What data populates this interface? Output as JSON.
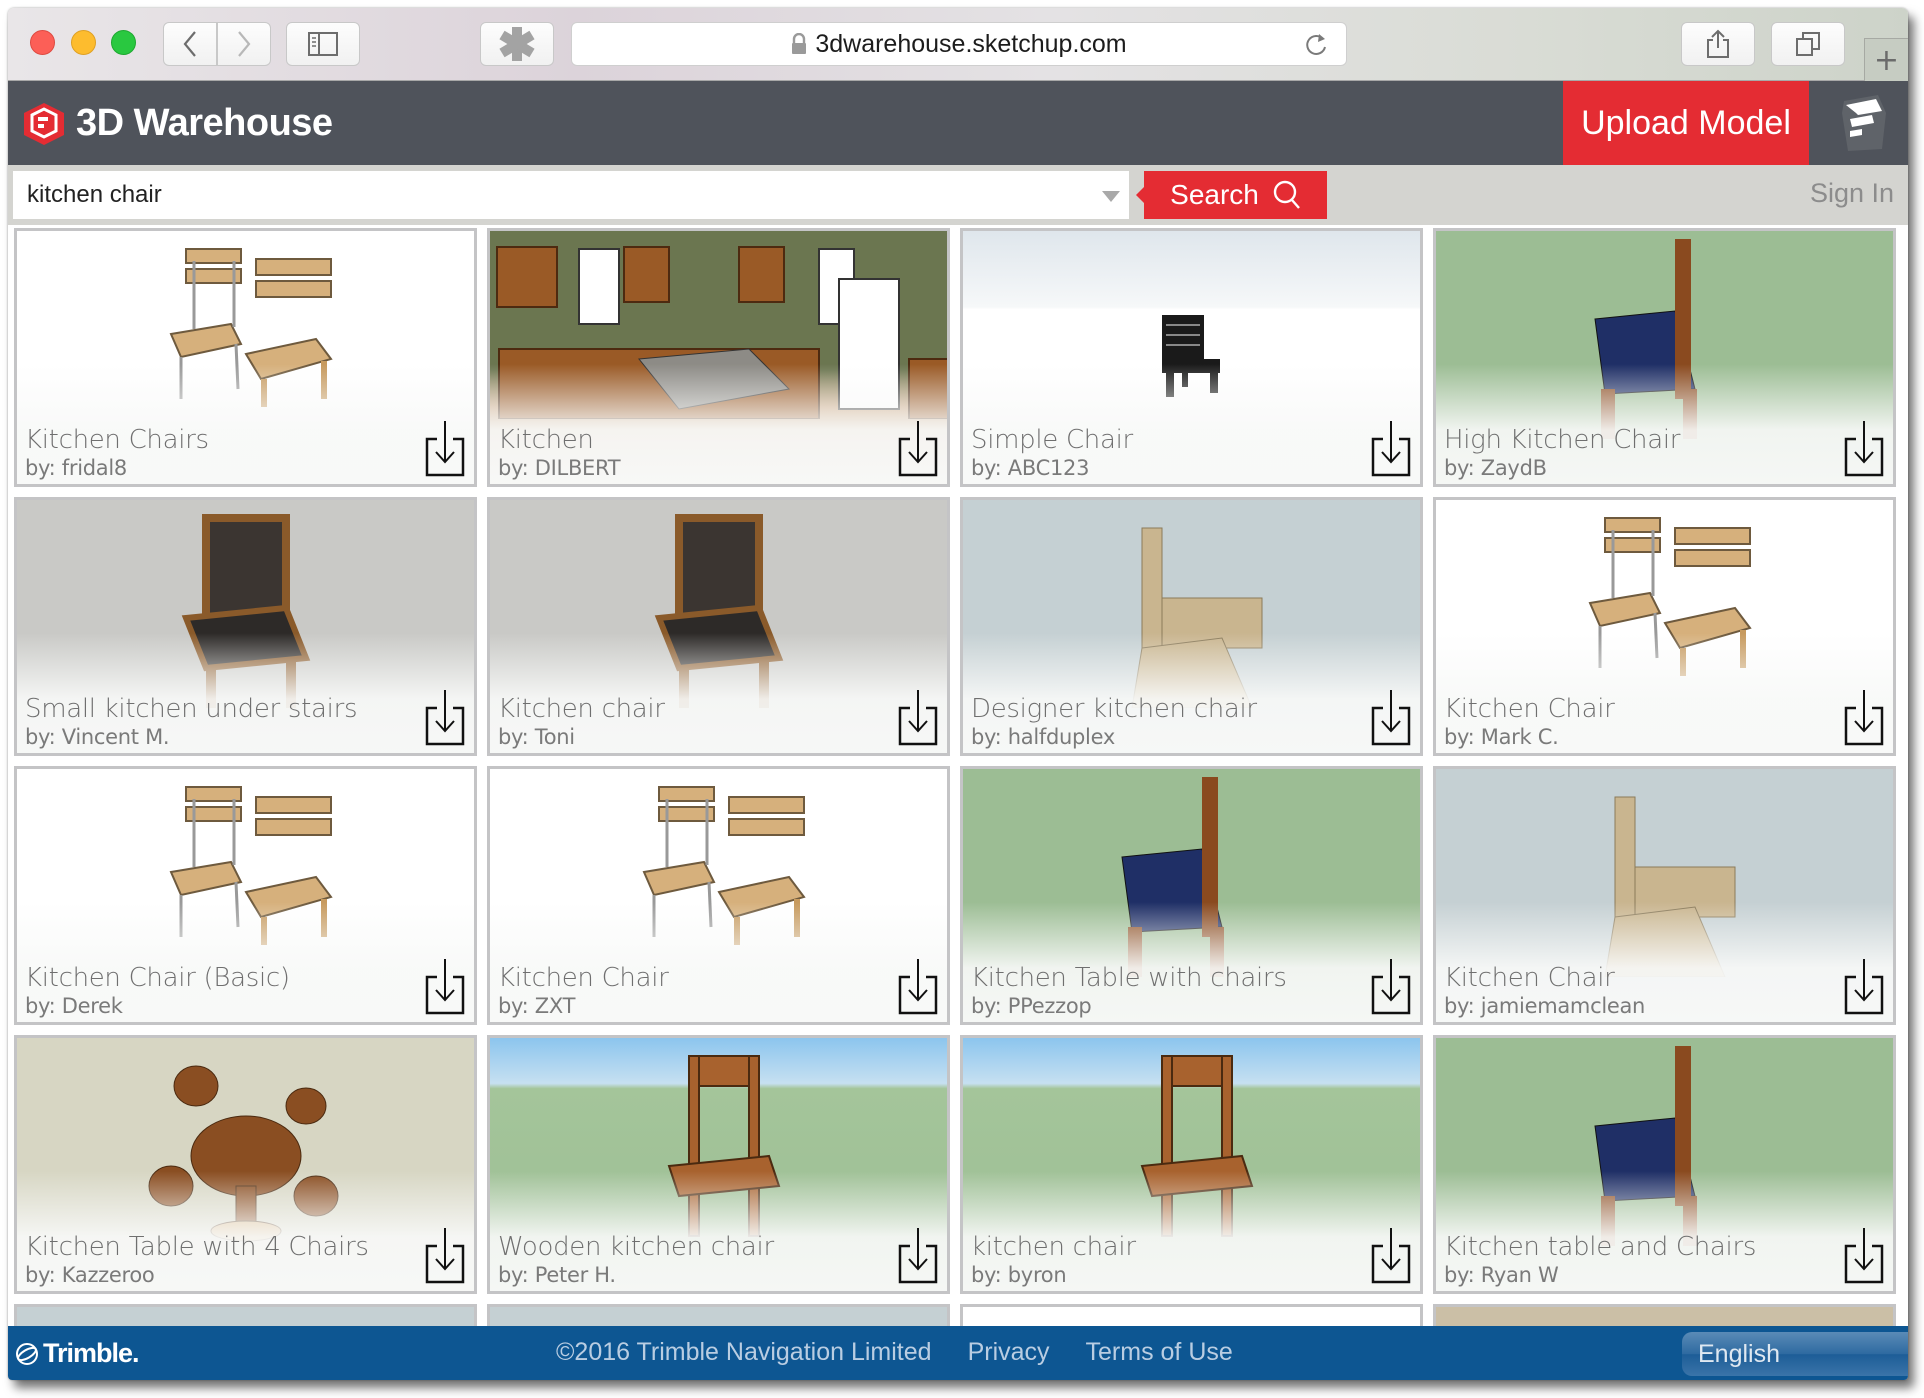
{
  "browser": {
    "url": "3dwarehouse.sketchup.com",
    "icons": {
      "back": "chevron-left-icon",
      "forward": "chevron-right-icon",
      "sidebar": "sidebar-icon",
      "extension": "asterisk-icon",
      "lock": "lock-icon",
      "reload": "reload-icon",
      "share": "share-icon",
      "tabs": "tabs-icon",
      "new_tab": "plus-icon"
    },
    "new_tab_label": "+"
  },
  "header": {
    "site_title": "3D Warehouse",
    "upload_label": "Upload Model",
    "brand_color": "#e42c33",
    "header_color": "#4f535b"
  },
  "search": {
    "value": "kitchen chair",
    "button_label": "Search",
    "sign_in_label": "Sign In"
  },
  "results": [
    {
      "title": "Kitchen Chairs",
      "author_prefix": "by:",
      "author": "fridal8",
      "scene": "white"
    },
    {
      "title": "Kitchen",
      "author_prefix": "by:",
      "author": "DILBERT",
      "scene": "kitchen"
    },
    {
      "title": "Simple Chair",
      "author_prefix": "by:",
      "author": "ABC123",
      "scene": "sky-white"
    },
    {
      "title": "High Kitchen Chair",
      "author_prefix": "by:",
      "author": "ZaydB",
      "scene": "green"
    },
    {
      "title": "Small kitchen under stairs",
      "author_prefix": "by:",
      "author": "Vincent M.",
      "scene": "grey"
    },
    {
      "title": "Kitchen chair",
      "author_prefix": "by:",
      "author": "Toni",
      "scene": "grey"
    },
    {
      "title": "Designer kitchen chair",
      "author_prefix": "by:",
      "author": "halfduplex",
      "scene": "blue-grey"
    },
    {
      "title": "Kitchen Chair",
      "author_prefix": "by:",
      "author": "Mark C.",
      "scene": "white"
    },
    {
      "title": "Kitchen Chair (Basic)",
      "author_prefix": "by:",
      "author": "Derek",
      "scene": "white"
    },
    {
      "title": "Kitchen Chair",
      "author_prefix": "by:",
      "author": "ZXT",
      "scene": "white"
    },
    {
      "title": "Kitchen Table with chairs",
      "author_prefix": "by:",
      "author": "PPezzop",
      "scene": "green"
    },
    {
      "title": "Kitchen Chair",
      "author_prefix": "by:",
      "author": "jamiemamclean",
      "scene": "blue-grey"
    },
    {
      "title": "Kitchen Table with 4 Chairs",
      "author_prefix": "by:",
      "author": "Kazzeroo",
      "scene": "beige"
    },
    {
      "title": "Wooden kitchen chair",
      "author_prefix": "by:",
      "author": "Peter H.",
      "scene": "sky-green"
    },
    {
      "title": "kitchen chair",
      "author_prefix": "by:",
      "author": "byron",
      "scene": "sky-green"
    },
    {
      "title": "Kitchen table and Chairs",
      "author_prefix": "by:",
      "author": "Ryan W",
      "scene": "green"
    }
  ],
  "download_icon": "download-icon",
  "footer": {
    "brand": "Trimble.",
    "copyright": "©2016 Trimble Navigation Limited",
    "privacy": "Privacy",
    "terms": "Terms of Use",
    "language": "English"
  }
}
